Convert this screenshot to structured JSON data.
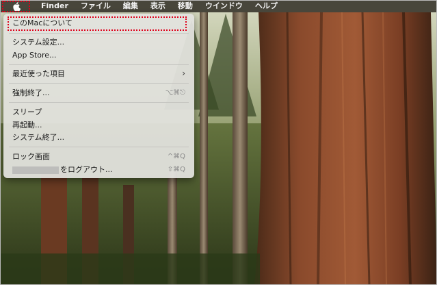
{
  "menubar": {
    "apple_icon": "apple-icon",
    "items": [
      {
        "label": "Finder"
      },
      {
        "label": "ファイル"
      },
      {
        "label": "編集"
      },
      {
        "label": "表示"
      },
      {
        "label": "移動"
      },
      {
        "label": "ウインドウ"
      },
      {
        "label": "ヘルプ"
      }
    ]
  },
  "apple_menu": {
    "about": "このMacについて",
    "system_settings": "システム設定...",
    "app_store": "App Store...",
    "recent_items": "最近使った項目",
    "force_quit": "強制終了...",
    "force_quit_shortcut": "⌥⌘⎋",
    "sleep": "スリープ",
    "restart": "再起動...",
    "shutdown": "システム終了...",
    "lock_screen": "ロック画面",
    "lock_screen_shortcut": "^⌘Q",
    "logout": "をログアウト...",
    "logout_shortcut": "⇧⌘Q"
  },
  "colors": {
    "highlight": "#e0001a",
    "menu_bg": "#e2e2de"
  }
}
